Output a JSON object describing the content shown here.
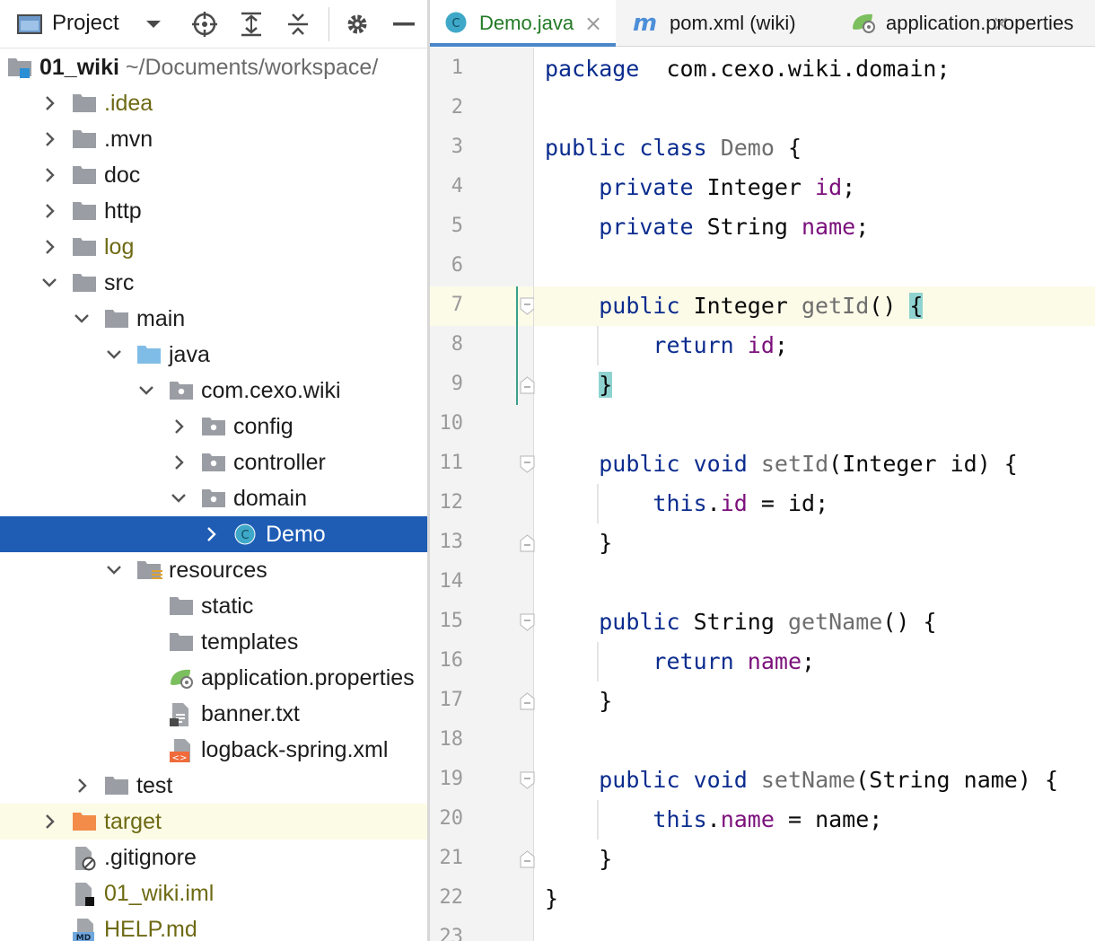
{
  "project_panel": {
    "title": "Project"
  },
  "tree": [
    {
      "label": "01_wiki",
      "path": " ~/Documents/workspace/",
      "indent": 0,
      "expanded": true,
      "icon": "module-icon",
      "style": "bold"
    },
    {
      "label": ".idea",
      "indent": 1,
      "expanded": false,
      "icon": "folder-icon",
      "style": "olive"
    },
    {
      "label": ".mvn",
      "indent": 1,
      "expanded": false,
      "icon": "folder-icon"
    },
    {
      "label": "doc",
      "indent": 1,
      "expanded": false,
      "icon": "folder-icon"
    },
    {
      "label": "http",
      "indent": 1,
      "expanded": false,
      "icon": "folder-icon"
    },
    {
      "label": "log",
      "indent": 1,
      "expanded": false,
      "icon": "folder-icon",
      "style": "olive"
    },
    {
      "label": "src",
      "indent": 1,
      "expanded": true,
      "icon": "folder-icon"
    },
    {
      "label": "main",
      "indent": 2,
      "expanded": true,
      "icon": "folder-icon"
    },
    {
      "label": "java",
      "indent": 3,
      "expanded": true,
      "icon": "source-folder-icon"
    },
    {
      "label": "com.cexo.wiki",
      "indent": 4,
      "expanded": true,
      "icon": "package-icon"
    },
    {
      "label": "config",
      "indent": 5,
      "expanded": false,
      "icon": "package-icon"
    },
    {
      "label": "controller",
      "indent": 5,
      "expanded": false,
      "icon": "package-icon"
    },
    {
      "label": "domain",
      "indent": 5,
      "expanded": true,
      "icon": "package-icon"
    },
    {
      "label": "Demo",
      "indent": 6,
      "expanded": false,
      "icon": "class-icon",
      "selected": true
    },
    {
      "label": "resources",
      "indent": 3,
      "expanded": true,
      "icon": "resources-folder-icon"
    },
    {
      "label": "static",
      "indent": 4,
      "icon": "folder-icon"
    },
    {
      "label": "templates",
      "indent": 4,
      "icon": "folder-icon"
    },
    {
      "label": "application.properties",
      "indent": 4,
      "icon": "spring-properties-icon"
    },
    {
      "label": "banner.txt",
      "indent": 4,
      "icon": "text-file-icon"
    },
    {
      "label": "logback-spring.xml",
      "indent": 4,
      "icon": "xml-file-icon"
    },
    {
      "label": "test",
      "indent": 2,
      "expanded": false,
      "icon": "folder-icon"
    },
    {
      "label": "target",
      "indent": 1,
      "expanded": false,
      "icon": "excluded-folder-icon",
      "style": "olive",
      "highlight": true
    },
    {
      "label": ".gitignore",
      "indent": 1,
      "icon": "gitignore-file-icon"
    },
    {
      "label": "01_wiki.iml",
      "indent": 1,
      "icon": "iml-file-icon",
      "style": "olive"
    },
    {
      "label": "HELP.md",
      "indent": 1,
      "icon": "markdown-file-icon",
      "style": "olive"
    }
  ],
  "tabs": [
    {
      "label": "Demo.java",
      "active": true,
      "icon": "class-icon",
      "closable": true
    },
    {
      "label": "pom.xml (wiki)",
      "active": false,
      "icon": "maven-icon",
      "closable": true
    },
    {
      "label": "application.properties",
      "active": false,
      "icon": "spring-properties-icon",
      "closable": false
    }
  ],
  "line_numbers": [
    "1",
    "2",
    "3",
    "4",
    "5",
    "6",
    "7",
    "8",
    "9",
    "10",
    "11",
    "12",
    "13",
    "14",
    "15",
    "16",
    "17",
    "18",
    "19",
    "20",
    "21",
    "22",
    "23"
  ],
  "code_lines": [
    [
      [
        "kw",
        "package"
      ],
      [
        "",
        "  com.cexo.wiki.domain;"
      ]
    ],
    [],
    [
      [
        "kw",
        "public"
      ],
      [
        "",
        " "
      ],
      [
        "kw",
        "class"
      ],
      [
        "",
        " "
      ],
      [
        "mth",
        "Demo"
      ],
      [
        "",
        " {"
      ]
    ],
    [
      [
        "",
        "    "
      ],
      [
        "kw",
        "private"
      ],
      [
        "",
        " Integer "
      ],
      [
        "fld",
        "id"
      ],
      [
        "",
        ";"
      ]
    ],
    [
      [
        "",
        "    "
      ],
      [
        "kw",
        "private"
      ],
      [
        "",
        " String "
      ],
      [
        "fld",
        "name"
      ],
      [
        "",
        ";"
      ]
    ],
    [],
    [
      [
        "",
        "    "
      ],
      [
        "kw",
        "public"
      ],
      [
        "",
        " Integer "
      ],
      [
        "mth",
        "getId"
      ],
      [
        "",
        "() "
      ],
      [
        "brace-hl",
        "{"
      ]
    ],
    [
      [
        "",
        "        "
      ],
      [
        "kw",
        "return"
      ],
      [
        "",
        " "
      ],
      [
        "fld",
        "id"
      ],
      [
        "",
        ";"
      ]
    ],
    [
      [
        "",
        "    "
      ],
      [
        "brace-hl",
        "}"
      ]
    ],
    [],
    [
      [
        "",
        "    "
      ],
      [
        "kw",
        "public"
      ],
      [
        "",
        " "
      ],
      [
        "kw",
        "void"
      ],
      [
        "",
        " "
      ],
      [
        "mth",
        "setId"
      ],
      [
        "",
        "(Integer id) {"
      ]
    ],
    [
      [
        "",
        "        "
      ],
      [
        "kw",
        "this"
      ],
      [
        "",
        "."
      ],
      [
        "fld",
        "id"
      ],
      [
        "",
        " = id;"
      ]
    ],
    [
      [
        "",
        "    }"
      ]
    ],
    [],
    [
      [
        "",
        "    "
      ],
      [
        "kw",
        "public"
      ],
      [
        "",
        " String "
      ],
      [
        "mth",
        "getName"
      ],
      [
        "",
        "() {"
      ]
    ],
    [
      [
        "",
        "        "
      ],
      [
        "kw",
        "return"
      ],
      [
        "",
        " "
      ],
      [
        "fld",
        "name"
      ],
      [
        "",
        ";"
      ]
    ],
    [
      [
        "",
        "    }"
      ]
    ],
    [],
    [
      [
        "",
        "    "
      ],
      [
        "kw",
        "public"
      ],
      [
        "",
        " "
      ],
      [
        "kw",
        "void"
      ],
      [
        "",
        " "
      ],
      [
        "mth",
        "setName"
      ],
      [
        "",
        "(String name) {"
      ]
    ],
    [
      [
        "",
        "        "
      ],
      [
        "kw",
        "this"
      ],
      [
        "",
        "."
      ],
      [
        "fld",
        "name"
      ],
      [
        "",
        " = name;"
      ]
    ],
    [
      [
        "",
        "    }"
      ]
    ],
    [
      [
        "",
        "}"
      ]
    ],
    []
  ],
  "current_line": 7,
  "colors": {
    "selection": "#1f5db5",
    "keyword": "#0b2c8e",
    "field": "#7b107b",
    "olive_text": "#6e6a14",
    "brace_match": "#8fd3d0",
    "tab_underline": "#4a86c8"
  }
}
